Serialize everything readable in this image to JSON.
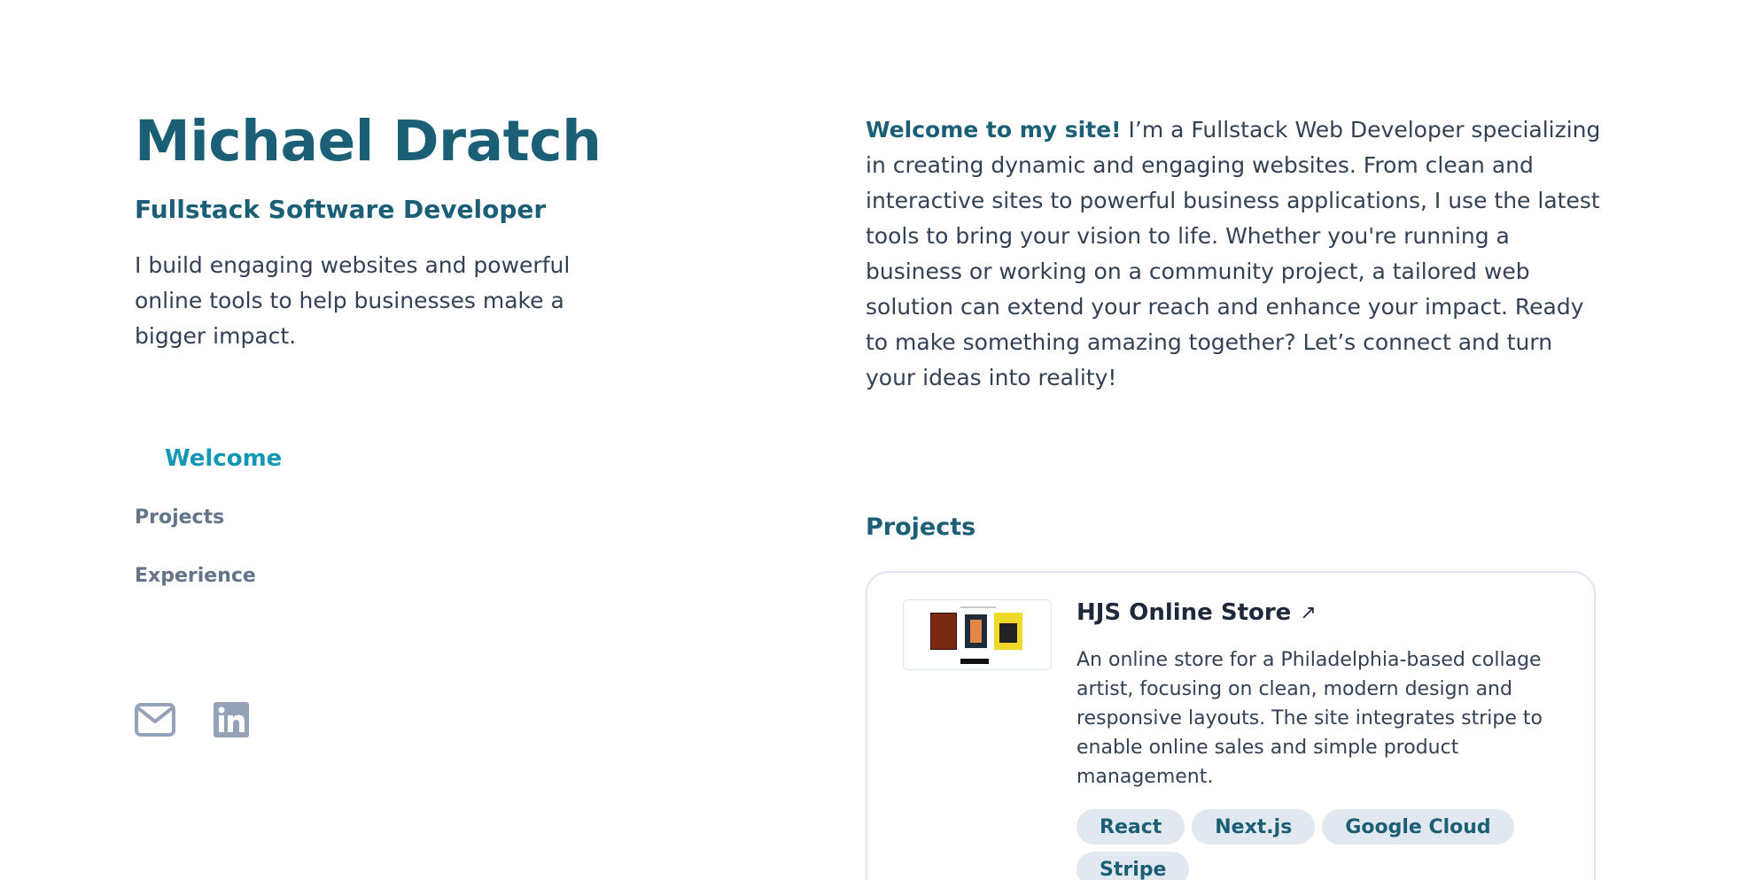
{
  "header": {
    "name": "Michael Dratch",
    "role": "Fullstack Software Developer",
    "intro": "I build engaging websites and powerful online tools to help businesses make a bigger impact."
  },
  "nav": {
    "items": [
      {
        "label": "Welcome",
        "active": true
      },
      {
        "label": "Projects",
        "active": false
      },
      {
        "label": "Experience",
        "active": false
      }
    ]
  },
  "socials": [
    {
      "icon": "mail-icon"
    },
    {
      "icon": "linkedin-icon"
    }
  ],
  "about": {
    "lead": "Welcome to my site!",
    "text": " I’m a Fullstack Web Developer specializing in creating dynamic and engaging websites. From clean and interactive sites to powerful business applications, I use the latest tools to bring your vision to life. Whether you're running a business or working on a community project, a tailored web solution can extend your reach and enhance your impact. Ready to make something amazing together? Let’s connect and turn your ideas into reality!"
  },
  "projects": {
    "title": "Projects",
    "items": [
      {
        "title": "HJS Online Store",
        "arrow": "↗",
        "description": "An online store for a Philadelphia-based collage artist, focusing on clean, modern design and responsive layouts. The site integrates stripe to enable online sales and simple product management.",
        "tags": [
          "React",
          "Next.js",
          "Google Cloud",
          "Stripe"
        ]
      }
    ]
  },
  "colors": {
    "accent": "#1b5f76",
    "active_nav": "#1496b5",
    "muted": "#64748b",
    "icon": "#94a3b8",
    "tag_bg": "#e2e8f0"
  }
}
